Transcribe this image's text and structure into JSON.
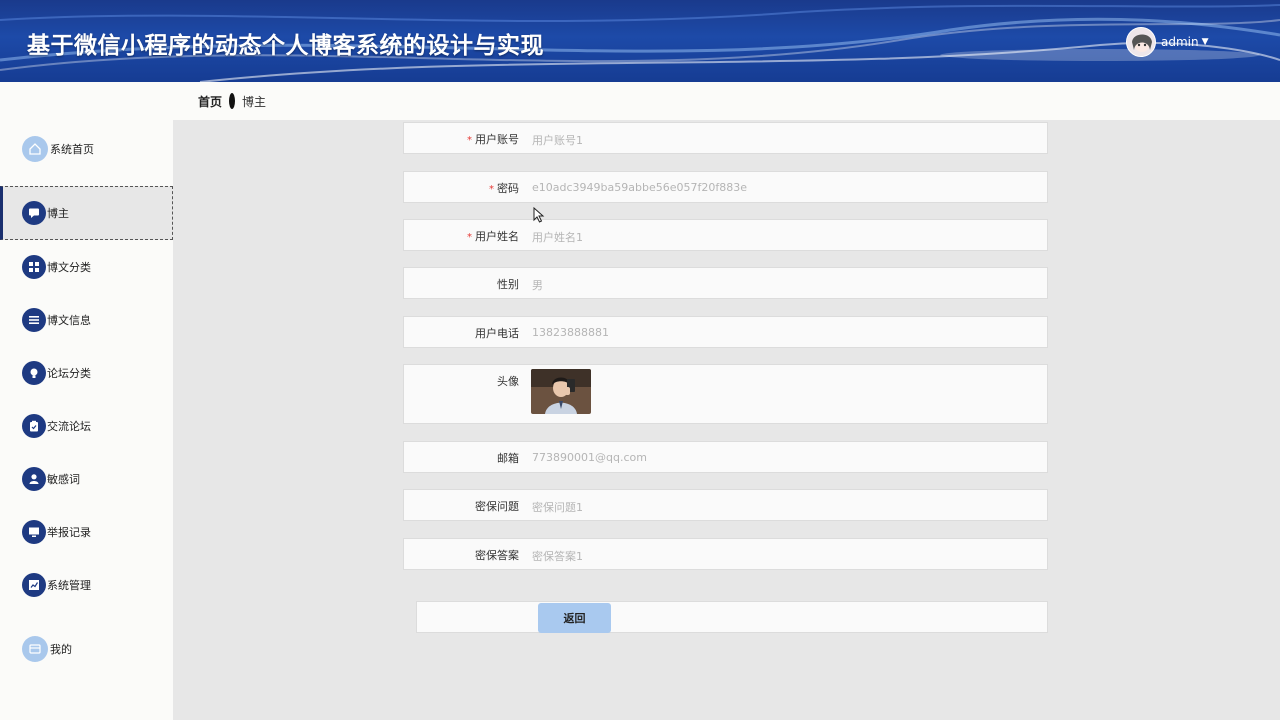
{
  "app": {
    "title": "基于微信小程序的动态个人博客系统的设计与实现"
  },
  "user": {
    "name": "admin",
    "caret": "▼"
  },
  "breadcrumb": {
    "home": "首页",
    "current": "博主"
  },
  "sidebar": {
    "items": [
      {
        "label": "系统首页",
        "icon": "home-icon"
      },
      {
        "label": "博主",
        "icon": "chat-icon",
        "active": true
      },
      {
        "label": "博文分类",
        "icon": "grid-icon"
      },
      {
        "label": "博文信息",
        "icon": "list-icon"
      },
      {
        "label": "论坛分类",
        "icon": "bulb-icon"
      },
      {
        "label": "交流论坛",
        "icon": "clipboard-icon"
      },
      {
        "label": "敏感词",
        "icon": "person-icon"
      },
      {
        "label": "举报记录",
        "icon": "monitor-icon"
      },
      {
        "label": "系统管理",
        "icon": "chart-icon"
      },
      {
        "label": "我的",
        "icon": "profile-card-icon"
      }
    ]
  },
  "form": {
    "fields": [
      {
        "label": "用户账号",
        "value": "用户账号1",
        "required": "*"
      },
      {
        "label": "密码",
        "value": "e10adc3949ba59abbe56e057f20f883e",
        "required": "*"
      },
      {
        "label": "用户姓名",
        "value": "用户姓名1",
        "required": "*"
      },
      {
        "label": "性别",
        "value": "男"
      },
      {
        "label": "用户电话",
        "value": "13823888881"
      },
      {
        "label": "头像"
      },
      {
        "label": "邮箱",
        "value": "773890001@qq.com"
      },
      {
        "label": "密保问题",
        "value": "密保问题1"
      },
      {
        "label": "密保答案",
        "value": "密保答案1"
      }
    ],
    "back_label": "返回"
  },
  "colors": {
    "header": "#1d4aa8",
    "accent": "#1e3a82",
    "button": "#a9c9ef",
    "required": "#e53935"
  }
}
